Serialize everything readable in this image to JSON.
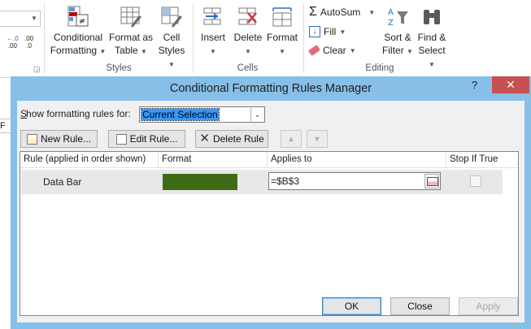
{
  "ribbon": {
    "styles_group": {
      "label": "Styles",
      "conditional_formatting": {
        "line1": "Conditional",
        "line2": "Formatting"
      },
      "format_as_table": {
        "line1": "Format as",
        "line2": "Table"
      },
      "cell_styles": {
        "line1": "Cell",
        "line2": "Styles"
      }
    },
    "cells_group": {
      "label": "Cells",
      "insert": "Insert",
      "delete": "Delete",
      "format": "Format"
    },
    "editing_group": {
      "label": "Editing",
      "autosum": "AutoSum",
      "fill": "Fill",
      "clear": "Clear",
      "sort_filter": {
        "line1": "Sort &",
        "line2": "Filter"
      },
      "find_select": {
        "line1": "Find &",
        "line2": "Select"
      }
    },
    "number_decrease_decimal": ".00",
    "number_increase_decimal": ".0"
  },
  "dialog": {
    "title": "Conditional Formatting Rules Manager",
    "help_glyph": "?",
    "close_glyph": "✕",
    "show_rules_label": "Show formatting rules for:",
    "show_rules_value": "Current Selection",
    "toolbar": {
      "new_rule": "New Rule...",
      "edit_rule": "Edit Rule...",
      "delete_rule": "Delete Rule"
    },
    "columns": [
      "Rule (applied in order shown)",
      "Format",
      "Applies to",
      "Stop If True"
    ],
    "rules": [
      {
        "rule": "Data Bar",
        "format_color": "#3f6b17",
        "applies_to": "=$B$3",
        "stop_if_true": false
      }
    ],
    "buttons": {
      "ok": "OK",
      "close": "Close",
      "apply": "Apply"
    }
  },
  "colors": {
    "dialog_frame": "#87bfe8",
    "close_button": "#c75050",
    "selected_row": "#e8e8e8"
  }
}
